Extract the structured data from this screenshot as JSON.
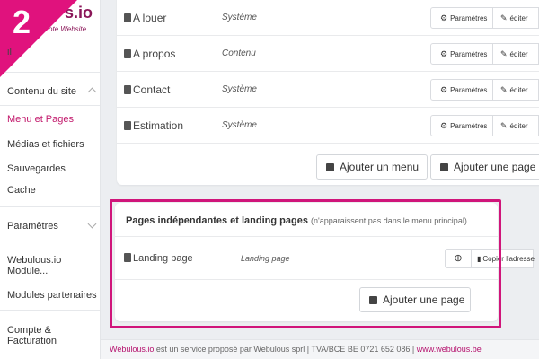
{
  "step_badge": "2",
  "logo": {
    "text": "s.io",
    "tagline": "ote Website"
  },
  "sidebar": {
    "top_item": "il",
    "sections": [
      {
        "label": "Contenu du site",
        "expanded": true,
        "items": [
          "Menu et Pages",
          "Médias et fichiers",
          "Sauvegardes",
          "Cache"
        ]
      },
      {
        "label": "Paramètres",
        "expanded": false
      },
      {
        "label": "Webulous.io Module..."
      },
      {
        "label": "Modules partenaires"
      },
      {
        "label": "Compte & Facturation"
      }
    ]
  },
  "menu_pages": [
    {
      "name": "A louer",
      "type": "Système"
    },
    {
      "name": "A propos",
      "type": "Contenu"
    },
    {
      "name": "Contact",
      "type": "Système"
    },
    {
      "name": "Estimation",
      "type": "Système"
    }
  ],
  "row_buttons": {
    "params": "Paramètres",
    "edit": "éditer"
  },
  "card1_actions": {
    "add_menu": "Ajouter un menu",
    "add_page": "Ajouter une page"
  },
  "landing": {
    "title": "Pages indépendantes et landing pages",
    "note": "(n'apparaissent pas dans le menu principal)",
    "row": {
      "name": "Landing page",
      "type": "Landing page",
      "copy": "Copier l'adresse"
    },
    "add_page": "Ajouter une page"
  },
  "footer": {
    "brand": "Webulous.io",
    "text": " est un service proposé par Webulous sprl | TVA/BCE BE 0721 652 086 | ",
    "link": "www.webulous.be"
  },
  "colors": {
    "accent": "#d0157a",
    "brand": "#8a1658"
  }
}
